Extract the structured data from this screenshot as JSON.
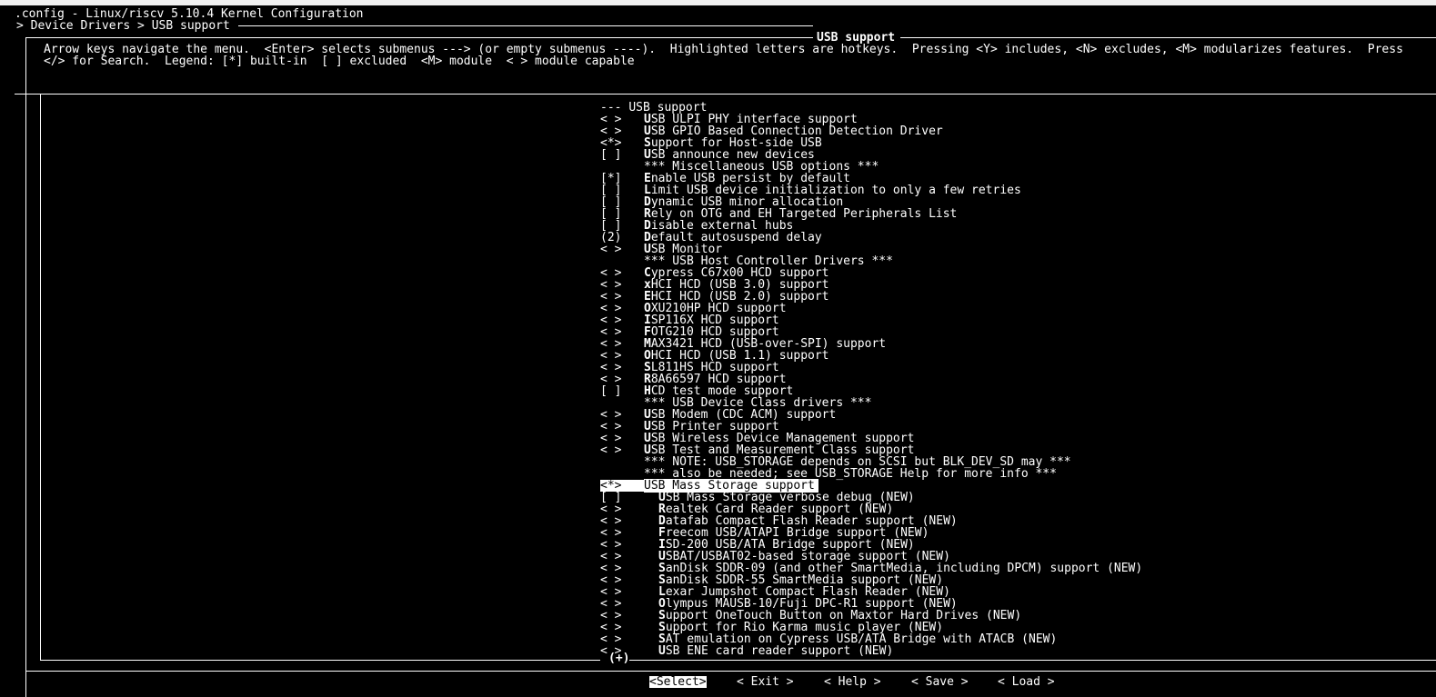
{
  "window": {
    "title": ".config - Linux/riscv 5.10.4 Kernel Configuration",
    "breadcrumb": "> Device Drivers > USB support"
  },
  "panel": {
    "title": "USB support",
    "help_line1": "Arrow keys navigate the menu.  <Enter> selects submenus ---> (or empty submenus ----).  Highlighted letters are hotkeys.  Pressing <Y> includes, <N> excludes, <M> modularizes features.  Press",
    "help_line2": "</> for Search.  Legend: [*] built-in  [ ] excluded  <M> module  < > module capable"
  },
  "menu_items": [
    {
      "mark": "--- ",
      "hot": "",
      "label": "USB support",
      "indent": false,
      "header": true
    },
    {
      "mark": "< >",
      "hot": "U",
      "label": "SB ULPI PHY interface support",
      "indent": false
    },
    {
      "mark": "< >",
      "hot": "U",
      "label": "SB GPIO Based Connection Detection Driver",
      "indent": false
    },
    {
      "mark": "<*>",
      "hot": "S",
      "label": "upport for Host-side USB",
      "indent": false
    },
    {
      "mark": "[ ]",
      "hot": "U",
      "label": "SB announce new devices",
      "indent": false
    },
    {
      "mark": "",
      "hot": "",
      "label": "*** Miscellaneous USB options ***",
      "indent": false
    },
    {
      "mark": "[*]",
      "hot": "E",
      "label": "nable USB persist by default",
      "indent": false
    },
    {
      "mark": "[ ]",
      "hot": "L",
      "label": "imit USB device initialization to only a few retries",
      "indent": false
    },
    {
      "mark": "[ ]",
      "hot": "D",
      "label": "ynamic USB minor allocation",
      "indent": false
    },
    {
      "mark": "[ ]",
      "hot": "R",
      "label": "ely on OTG and EH Targeted Peripherals List",
      "indent": false
    },
    {
      "mark": "[ ]",
      "hot": "D",
      "label": "isable external hubs",
      "indent": false
    },
    {
      "mark": "(2)",
      "hot": "D",
      "label": "efault autosuspend delay",
      "indent": false
    },
    {
      "mark": "< >",
      "hot": "U",
      "label": "SB Monitor",
      "indent": false
    },
    {
      "mark": "",
      "hot": "",
      "label": "*** USB Host Controller Drivers ***",
      "indent": false
    },
    {
      "mark": "< >",
      "hot": "C",
      "label": "ypress C67x00 HCD support",
      "indent": false
    },
    {
      "mark": "< >",
      "hot": "x",
      "label": "HCI HCD (USB 3.0) support",
      "indent": false
    },
    {
      "mark": "< >",
      "hot": "E",
      "label": "HCI HCD (USB 2.0) support",
      "indent": false
    },
    {
      "mark": "< >",
      "hot": "O",
      "label": "XU210HP HCD support",
      "indent": false
    },
    {
      "mark": "< >",
      "hot": "I",
      "label": "SP116X HCD support",
      "indent": false
    },
    {
      "mark": "< >",
      "hot": "F",
      "label": "OTG210 HCD support",
      "indent": false
    },
    {
      "mark": "< >",
      "hot": "M",
      "label": "AX3421 HCD (USB-over-SPI) support",
      "indent": false
    },
    {
      "mark": "< >",
      "hot": "O",
      "label": "HCI HCD (USB 1.1) support",
      "indent": false
    },
    {
      "mark": "< >",
      "hot": "S",
      "label": "L811HS HCD support",
      "indent": false
    },
    {
      "mark": "< >",
      "hot": "R",
      "label": "8A66597 HCD support",
      "indent": false
    },
    {
      "mark": "[ ]",
      "hot": "H",
      "label": "CD test mode support",
      "indent": false
    },
    {
      "mark": "",
      "hot": "",
      "label": "*** USB Device Class drivers ***",
      "indent": false
    },
    {
      "mark": "< >",
      "hot": "U",
      "label": "SB Modem (CDC ACM) support",
      "indent": false
    },
    {
      "mark": "< >",
      "hot": "U",
      "label": "SB Printer support",
      "indent": false
    },
    {
      "mark": "< >",
      "hot": "U",
      "label": "SB Wireless Device Management support",
      "indent": false
    },
    {
      "mark": "< >",
      "hot": "U",
      "label": "SB Test and Measurement Class support",
      "indent": false
    },
    {
      "mark": "",
      "hot": "",
      "label": "*** NOTE: USB_STORAGE depends on SCSI but BLK_DEV_SD may ***",
      "indent": false
    },
    {
      "mark": "",
      "hot": "",
      "label": "*** also be needed; see USB_STORAGE Help for more info ***",
      "indent": false
    },
    {
      "mark": "<*>",
      "hot": "",
      "label": "USB Mass Storage support",
      "indent": false,
      "selected": true
    },
    {
      "mark": "[ ]",
      "hot": "U",
      "label": "SB Mass Storage verbose debug (NEW)",
      "indent": true
    },
    {
      "mark": "< >",
      "hot": "R",
      "label": "ealtek Card Reader support (NEW)",
      "indent": true
    },
    {
      "mark": "< >",
      "hot": "D",
      "label": "atafab Compact Flash Reader support (NEW)",
      "indent": true
    },
    {
      "mark": "< >",
      "hot": "F",
      "label": "reecom USB/ATAPI Bridge support (NEW)",
      "indent": true
    },
    {
      "mark": "< >",
      "hot": "I",
      "label": "SD-200 USB/ATA Bridge support (NEW)",
      "indent": true
    },
    {
      "mark": "< >",
      "hot": "U",
      "label": "SBAT/USBAT02-based storage support (NEW)",
      "indent": true
    },
    {
      "mark": "< >",
      "hot": "S",
      "label": "anDisk SDDR-09 (and other SmartMedia, including DPCM) support (NEW)",
      "indent": true
    },
    {
      "mark": "< >",
      "hot": "S",
      "label": "anDisk SDDR-55 SmartMedia support (NEW)",
      "indent": true
    },
    {
      "mark": "< >",
      "hot": "L",
      "label": "exar Jumpshot Compact Flash Reader (NEW)",
      "indent": true
    },
    {
      "mark": "< >",
      "hot": "O",
      "label": "lympus MAUSB-10/Fuji DPC-R1 support (NEW)",
      "indent": true
    },
    {
      "mark": "< >",
      "hot": "S",
      "label": "upport OneTouch Button on Maxtor Hard Drives (NEW)",
      "indent": true
    },
    {
      "mark": "< >",
      "hot": "S",
      "label": "upport for Rio Karma music player (NEW)",
      "indent": true
    },
    {
      "mark": "< >",
      "hot": "S",
      "label": "AT emulation on Cypress USB/ATA Bridge with ATACB (NEW)",
      "indent": true
    },
    {
      "mark": "< >",
      "hot": "U",
      "label": "SB ENE card reader support (NEW)",
      "indent": true
    }
  ],
  "scroll_indicator": "(+)",
  "buttons": {
    "select": "<Select>",
    "exit": "< Exit >",
    "help": "< Help >",
    "save": "< Save >",
    "load": "< Load >"
  }
}
